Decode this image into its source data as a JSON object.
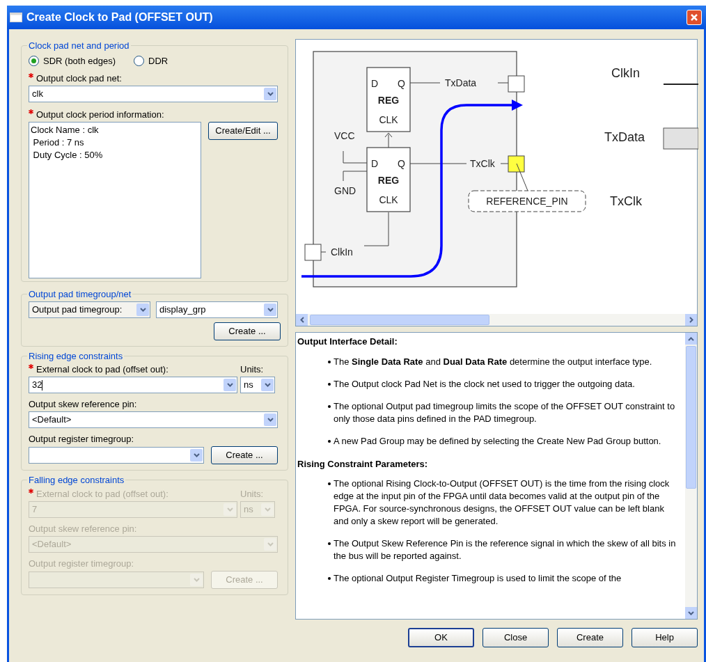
{
  "window": {
    "title": "Create Clock to Pad (OFFSET OUT)"
  },
  "clock_pad": {
    "title": "Clock pad net and period",
    "radios": [
      {
        "label": "SDR (both edges)",
        "selected": true
      },
      {
        "label": "DDR",
        "selected": false
      }
    ],
    "pad_net": {
      "label": "Output clock pad net:",
      "required": true,
      "value": "clk"
    },
    "period_info": {
      "label": "Output clock period information:",
      "required": true,
      "lines": [
        "Clock Name : clk",
        " Period : 7 ns",
        " Duty Cycle : 50%"
      ]
    },
    "create_edit": "Create/Edit ..."
  },
  "output_pad": {
    "title": "Output pad timegroup/net",
    "type_value": "Output pad timegroup:",
    "group_value": "display_grp",
    "create": "Create ..."
  },
  "edge_groups": [
    {
      "title": "Rising edge constraints",
      "disabled": false,
      "offset": {
        "label": "External clock to pad (offset out):",
        "required": true,
        "value": "32"
      },
      "units": {
        "label": "Units:",
        "value": "ns"
      },
      "skew": {
        "label": "Output skew reference pin:",
        "value": "<Default>"
      },
      "register": {
        "label": "Output register timegroup:"
      },
      "create": "Create ..."
    },
    {
      "title": "Falling edge constraints",
      "disabled": true,
      "offset": {
        "label": "External clock to pad (offset out):",
        "required": true,
        "value": "7"
      },
      "units": {
        "label": "Units:",
        "value": "ns"
      },
      "skew": {
        "label": "Output skew reference pin:",
        "value": "<Default>"
      },
      "register": {
        "label": "Output register timegroup:"
      },
      "create": "Create ..."
    }
  ],
  "diagram": {
    "registers": [
      {
        "d": "D",
        "q": "Q",
        "name": "REG",
        "clk": "CLK"
      },
      {
        "d": "D",
        "q": "Q",
        "name": "REG",
        "clk": "CLK"
      }
    ],
    "vcc": "VCC",
    "gnd": "GND",
    "txdata": "TxData",
    "txclk": "TxClk",
    "clkin": "ClkIn",
    "reference": "REFERENCE_PIN",
    "signals": [
      "ClkIn",
      "TxData",
      "TxClk"
    ]
  },
  "help": {
    "sections": [
      {
        "heading": "Output Interface Detail:",
        "bullets": [
          "The **Single Data Rate** and **Dual Data Rate** determine the output interface type.",
          "The Output clock Pad Net is the clock net used to trigger the outgoing data.",
          "The optional Output pad timegroup limits the scope of the OFFSET OUT constraint to only those data pins defined in the PAD timegroup.",
          "A new Pad Group may be defined by selecting the Create New Pad Group button."
        ]
      },
      {
        "heading": "Rising Constraint Parameters:",
        "bullets": [
          "The optional Rising Clock-to-Output (OFFSET OUT) is the time from the rising clock edge at the input pin of the FPGA until data becomes valid at the output pin of the FPGA. For source-synchronous designs, the OFFSET OUT value can be left blank and only a skew report will be generated.",
          "The Output Skew Reference Pin is the reference signal in which the skew of all bits in the bus will be reported against.",
          "The optional Output Register Timegroup is used to limit the scope of the"
        ]
      }
    ]
  },
  "buttons": [
    {
      "label": "OK",
      "default": true
    },
    {
      "label": "Close",
      "default": false
    },
    {
      "label": "Create",
      "default": false
    },
    {
      "label": "Help",
      "default": false
    }
  ]
}
